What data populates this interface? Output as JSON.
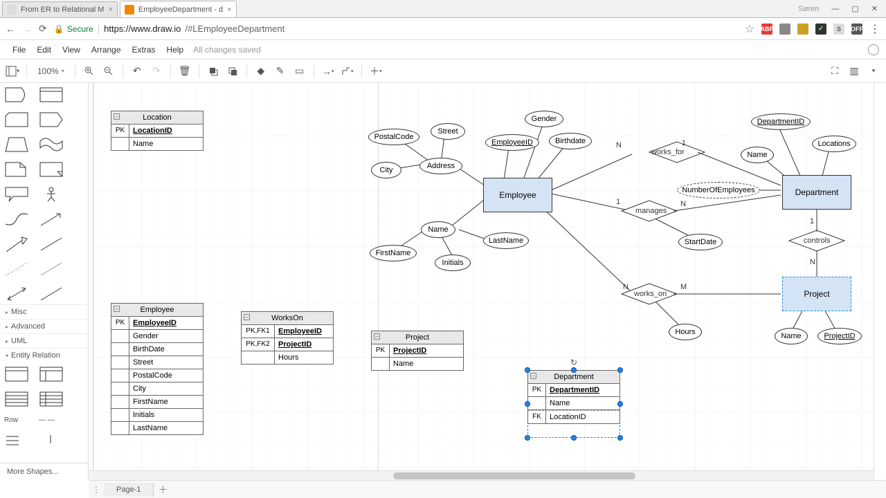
{
  "browser": {
    "tabs": [
      {
        "title": "From ER to Relational M",
        "active": false
      },
      {
        "title": "EmployeeDepartment - d",
        "active": true
      }
    ],
    "user_label": "Søren",
    "secure_label": "Secure",
    "url_host": "https://www.draw.io",
    "url_path": "/#LEmployeeDepartment",
    "star": "☆"
  },
  "menus": {
    "file": "File",
    "edit": "Edit",
    "view": "View",
    "arrange": "Arrange",
    "extras": "Extras",
    "help": "Help",
    "save_status": "All changes saved"
  },
  "toolbar": {
    "zoom": "100%"
  },
  "sidebar": {
    "sections": {
      "misc": "Misc",
      "advanced": "Advanced",
      "uml": "UML",
      "er": "Entity Relation"
    },
    "row_label": "Row",
    "more": "More Shapes..."
  },
  "page_tab": "Page-1",
  "tables": {
    "location": {
      "title": "Location",
      "rows": [
        {
          "key": "PK",
          "val": "LocationID",
          "pk": true
        },
        {
          "key": "",
          "val": "Name"
        }
      ]
    },
    "employee": {
      "title": "Employee",
      "rows": [
        {
          "key": "PK",
          "val": "EmployeeID",
          "pk": true
        },
        {
          "key": "",
          "val": "Gender"
        },
        {
          "key": "",
          "val": "BirthDate"
        },
        {
          "key": "",
          "val": "Street"
        },
        {
          "key": "",
          "val": "PostalCode"
        },
        {
          "key": "",
          "val": "City"
        },
        {
          "key": "",
          "val": "FirstName"
        },
        {
          "key": "",
          "val": "Initials"
        },
        {
          "key": "",
          "val": "LastName"
        }
      ]
    },
    "workson": {
      "title": "WorksOn",
      "rows": [
        {
          "key": "PK,FK1",
          "val": "EmployeeID",
          "pk": true
        },
        {
          "key": "PK,FK2",
          "val": "ProjectID",
          "pk": true
        },
        {
          "key": "",
          "val": "Hours"
        }
      ]
    },
    "project": {
      "title": "Project",
      "rows": [
        {
          "key": "PK",
          "val": "ProjectID",
          "pk": true
        },
        {
          "key": "",
          "val": "Name"
        }
      ]
    },
    "department": {
      "title": "Department",
      "rows": [
        {
          "key": "PK",
          "val": "DepartmentID",
          "pk": true
        },
        {
          "key": "",
          "val": "Name"
        },
        {
          "key": "FK",
          "val": "LocationID"
        }
      ]
    }
  },
  "er": {
    "employee": "Employee",
    "department": "Department",
    "project": "Project",
    "attrs": {
      "postalcode": "PostalCode",
      "street": "Street",
      "city": "City",
      "address": "Address",
      "employeeid": "EmployeeID",
      "gender": "Gender",
      "birthdate": "Birthdate",
      "name_emp": "Name",
      "firstname": "FirstName",
      "lastname": "LastName",
      "initials": "Initials",
      "departmentid": "DepartmentID",
      "locations": "Locations",
      "name_dept": "Name",
      "numberofemployees": "NumberOfEmployees",
      "startdate": "StartDate",
      "hours": "Hours",
      "name_proj": "Name",
      "projectid": "ProjectID"
    },
    "rels": {
      "works_for": "works_for",
      "manages": "manages",
      "works_on": "works_on",
      "controls": "controls"
    },
    "card": {
      "n": "N",
      "m": "M",
      "one": "1"
    }
  }
}
